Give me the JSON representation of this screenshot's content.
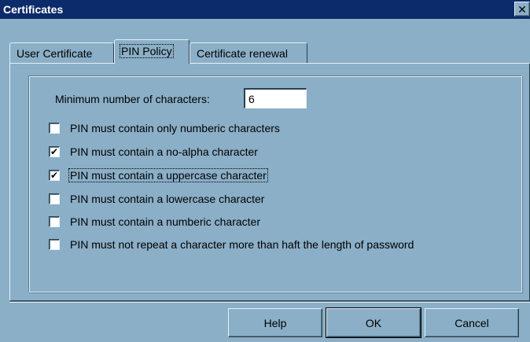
{
  "window": {
    "title": "Certificates",
    "close_glyph": "✕"
  },
  "tabs": [
    {
      "label": "User Certificate",
      "active": false
    },
    {
      "label": "PIN Policy",
      "active": true
    },
    {
      "label": "Certificate renewal",
      "active": false
    }
  ],
  "pin_policy": {
    "min_chars_label": "Minimum number of characters:",
    "min_chars_value": "6",
    "options": [
      {
        "label": "PIN must contain only numberic characters",
        "checked": false
      },
      {
        "label": "PIN must contain a no-alpha character",
        "checked": true
      },
      {
        "label": "PIN must contain a uppercase character",
        "checked": true
      },
      {
        "label": "PIN must contain a lowercase character",
        "checked": false
      },
      {
        "label": "PIN must contain a numberic character",
        "checked": false
      },
      {
        "label": "PIN must not repeat a character more than haft the length of password",
        "checked": false
      }
    ]
  },
  "buttons": {
    "help": "Help",
    "ok": "OK",
    "cancel": "Cancel"
  },
  "colors": {
    "titlebar": "#0b2b6a",
    "face": "#8aafc7"
  }
}
